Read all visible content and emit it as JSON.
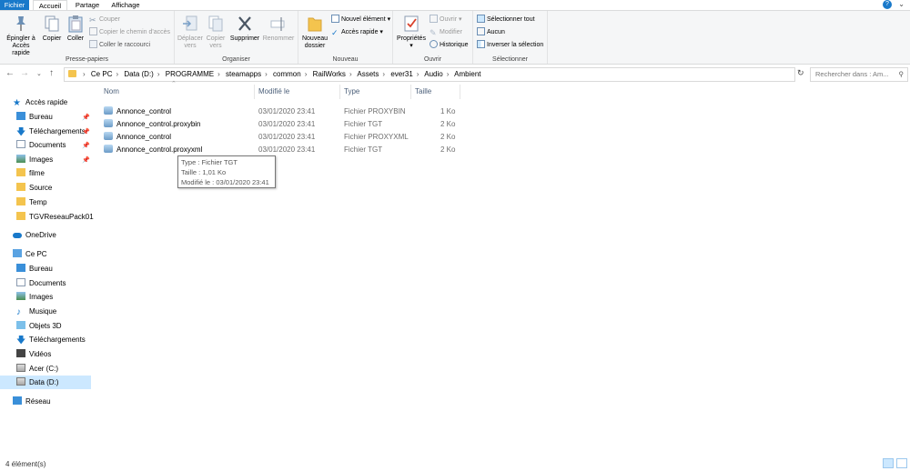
{
  "tabs": [
    "Fichier",
    "Accueil",
    "Partage",
    "Affichage"
  ],
  "ribbon": {
    "clipboard": {
      "label": "Presse-papiers",
      "pin": "Épingler à\nAccès rapide",
      "copy": "Copier",
      "paste": "Coller",
      "cut": "Couper",
      "copy_path": "Copier le chemin d'accès",
      "paste_shortcut": "Coller le raccourci"
    },
    "organize": {
      "label": "Organiser",
      "move": "Déplacer\nvers",
      "copy_to": "Copier\nvers",
      "delete": "Supprimer",
      "rename": "Renommer"
    },
    "new": {
      "label": "Nouveau",
      "new_folder": "Nouveau\ndossier",
      "new_item": "Nouvel élément",
      "quick_access": "Accès rapide"
    },
    "open": {
      "label": "Ouvrir",
      "properties": "Propriétés",
      "open": "Ouvrir",
      "edit": "Modifier",
      "history": "Historique"
    },
    "select": {
      "label": "Sélectionner",
      "select_all": "Sélectionner tout",
      "select_none": "Aucun",
      "invert": "Inverser la sélection"
    }
  },
  "address": {
    "crumbs": [
      "Ce PC",
      "Data (D:)",
      "PROGRAMME",
      "steamapps",
      "common",
      "RailWorks",
      "Assets",
      "ever31",
      "Audio",
      "Ambient"
    ],
    "search_placeholder": "Rechercher dans : Am..."
  },
  "sidebar": {
    "quick_access": "Accès rapide",
    "quick_items": [
      {
        "label": "Bureau",
        "pinned": true
      },
      {
        "label": "Téléchargements",
        "pinned": true
      },
      {
        "label": "Documents",
        "pinned": true
      },
      {
        "label": "Images",
        "pinned": true
      },
      {
        "label": "filme",
        "pinned": false
      },
      {
        "label": "Source",
        "pinned": false
      },
      {
        "label": "Temp",
        "pinned": false
      },
      {
        "label": "TGVReseauPack01",
        "pinned": false
      }
    ],
    "onedrive": "OneDrive",
    "this_pc": "Ce PC",
    "pc_items": [
      "Bureau",
      "Documents",
      "Images",
      "Musique",
      "Objets 3D",
      "Téléchargements",
      "Vidéos",
      "Acer (C:)",
      "Data (D:)"
    ],
    "network": "Réseau"
  },
  "columns": [
    "Nom",
    "Modifié le",
    "Type",
    "Taille"
  ],
  "files": [
    {
      "name": "Annonce_control",
      "modified": "03/01/2020 23:41",
      "type": "Fichier PROXYBIN",
      "size": "1 Ko"
    },
    {
      "name": "Annonce_control.proxybin",
      "modified": "03/01/2020 23:41",
      "type": "Fichier TGT",
      "size": "2 Ko"
    },
    {
      "name": "Annonce_control",
      "modified": "03/01/2020 23:41",
      "type": "Fichier PROXYXML",
      "size": "2 Ko"
    },
    {
      "name": "Annonce_control.proxyxml",
      "modified": "03/01/2020 23:41",
      "type": "Fichier TGT",
      "size": "2 Ko"
    }
  ],
  "tooltip": {
    "type": "Type : Fichier TGT",
    "size": "Taille : 1,01 Ko",
    "modified": "Modifié le : 03/01/2020 23:41"
  },
  "status": "4 élément(s)",
  "colors": {
    "accent": "#1979ca",
    "folder": "#f4c44e",
    "selection": "#cce8ff"
  }
}
